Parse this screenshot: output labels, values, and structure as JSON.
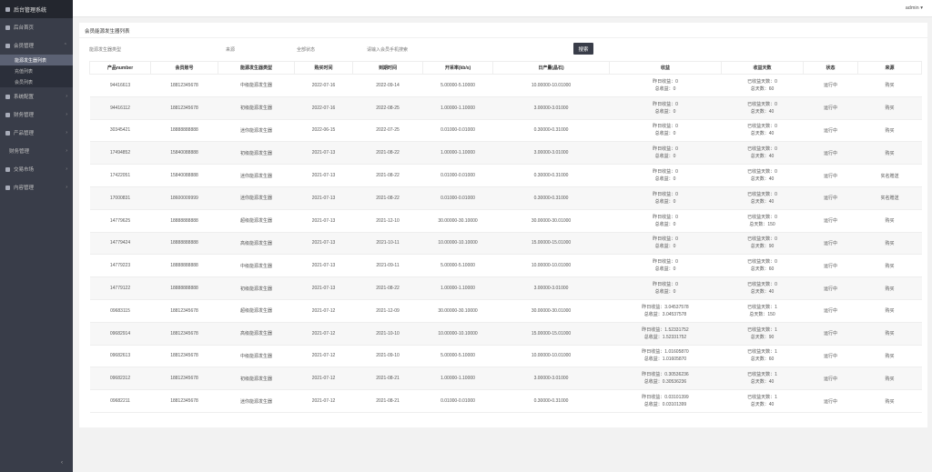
{
  "sidebar": {
    "logo_text": "后台管理系统",
    "items": [
      {
        "label": "后台首页",
        "icon": "home-icon",
        "has_arrow": false,
        "selected": false
      },
      {
        "label": "会员管理",
        "icon": "user-icon",
        "has_arrow": true,
        "selected": false,
        "expanded": true
      },
      {
        "label": "系统配置",
        "icon": "gear-icon",
        "has_arrow": true,
        "selected": false
      },
      {
        "label": "财务管理",
        "icon": "wallet-icon",
        "has_arrow": true,
        "selected": false
      },
      {
        "label": "产品管理",
        "icon": "box-icon",
        "has_arrow": true,
        "selected": false
      },
      {
        "label": "财务管理",
        "icon": "finance-icon",
        "has_arrow": true,
        "selected": false,
        "no_icon": true
      },
      {
        "label": "交易市场",
        "icon": "market-icon",
        "has_arrow": true,
        "selected": false
      },
      {
        "label": "内容管理",
        "icon": "doc-icon",
        "has_arrow": true,
        "selected": false
      }
    ],
    "submenu": [
      {
        "label": "能源发生器列表",
        "active": true
      },
      {
        "label": "充值列表",
        "active": false
      },
      {
        "label": "会员列表",
        "active": false
      }
    ],
    "collapse_glyph": "‹"
  },
  "topbar": {
    "user": "admin"
  },
  "panel": {
    "title": "会员能源发生器列表",
    "filters": [
      "能源发生器类型",
      "来源",
      "全部状态",
      "请输入会员手机搜索"
    ],
    "search_label": "搜索"
  },
  "table": {
    "columns": [
      "产品number",
      "会员账号",
      "能源发生器类型",
      "购买时间",
      "到期时间",
      "开采率(kb/s)",
      "日产量(晶石)",
      "收益",
      "收益天数",
      "状态",
      "来源"
    ],
    "rows": [
      {
        "id": "94416613",
        "account": "18812345678",
        "type": "中级能源发生器",
        "buy": "2022-07-16",
        "expire": "2022-09-14",
        "rate": "5.00000-5.10000",
        "daily": "10.00000-10.01000",
        "inc1": "昨日收益：0",
        "inc2": "总收益：0",
        "d1": "已收益天数：0",
        "d2": "总天数：60",
        "status": "运行中",
        "source": "购买"
      },
      {
        "id": "94416112",
        "account": "18812345678",
        "type": "初级能源发生器",
        "buy": "2022-07-16",
        "expire": "2022-08-25",
        "rate": "1.00000-1.10000",
        "daily": "3.00000-3.01000",
        "inc1": "昨日收益：0",
        "inc2": "总收益：0",
        "d1": "已收益天数：0",
        "d2": "总天数：40",
        "status": "运行中",
        "source": "购买"
      },
      {
        "id": "30345421",
        "account": "18888888888",
        "type": "迷你能源发生器",
        "buy": "2022-06-15",
        "expire": "2022-07-25",
        "rate": "0.01000-0.01000",
        "daily": "0.30000-0.31000",
        "inc1": "昨日收益：0",
        "inc2": "总收益：0",
        "d1": "已收益天数：0",
        "d2": "总天数：40",
        "status": "运行中",
        "source": "购买"
      },
      {
        "id": "17494852",
        "account": "15840088888",
        "type": "初级能源发生器",
        "buy": "2021-07-13",
        "expire": "2021-08-22",
        "rate": "1.00000-1.10000",
        "daily": "3.00000-3.01000",
        "inc1": "昨日收益：0",
        "inc2": "总收益：0",
        "d1": "已收益天数：0",
        "d2": "总天数：40",
        "status": "运行中",
        "source": "购买"
      },
      {
        "id": "17422051",
        "account": "15840088888",
        "type": "迷你能源发生器",
        "buy": "2021-07-13",
        "expire": "2021-08-22",
        "rate": "0.01000-0.01000",
        "daily": "0.30000-0.31000",
        "inc1": "昨日收益：0",
        "inc2": "总收益：0",
        "d1": "已收益天数：0",
        "d2": "总天数：40",
        "status": "运行中",
        "source": "实名赠送"
      },
      {
        "id": "17000831",
        "account": "18600009999",
        "type": "迷你能源发生器",
        "buy": "2021-07-13",
        "expire": "2021-08-22",
        "rate": "0.01000-0.01000",
        "daily": "0.30000-0.31000",
        "inc1": "昨日收益：0",
        "inc2": "总收益：0",
        "d1": "已收益天数：0",
        "d2": "总天数：40",
        "status": "运行中",
        "source": "实名赠送"
      },
      {
        "id": "14779625",
        "account": "18888888888",
        "type": "超级能源发生器",
        "buy": "2021-07-13",
        "expire": "2021-12-10",
        "rate": "30.00000-30.10000",
        "daily": "30.00000-30.01000",
        "inc1": "昨日收益：0",
        "inc2": "总收益：0",
        "d1": "已收益天数：0",
        "d2": "总天数：150",
        "status": "运行中",
        "source": "购买"
      },
      {
        "id": "14779424",
        "account": "18888888888",
        "type": "高级能源发生器",
        "buy": "2021-07-13",
        "expire": "2021-10-11",
        "rate": "10.00000-10.10000",
        "daily": "15.00000-15.01000",
        "inc1": "昨日收益：0",
        "inc2": "总收益：0",
        "d1": "已收益天数：0",
        "d2": "总天数：90",
        "status": "运行中",
        "source": "购买"
      },
      {
        "id": "14779223",
        "account": "18888888888",
        "type": "中级能源发生器",
        "buy": "2021-07-13",
        "expire": "2021-09-11",
        "rate": "5.00000-5.10000",
        "daily": "10.00000-10.01000",
        "inc1": "昨日收益：0",
        "inc2": "总收益：0",
        "d1": "已收益天数：0",
        "d2": "总天数：60",
        "status": "运行中",
        "source": "购买"
      },
      {
        "id": "14779122",
        "account": "18888888888",
        "type": "初级能源发生器",
        "buy": "2021-07-13",
        "expire": "2021-08-22",
        "rate": "1.00000-1.10000",
        "daily": "3.00000-3.01000",
        "inc1": "昨日收益：0",
        "inc2": "总收益：0",
        "d1": "已收益天数：0",
        "d2": "总天数：40",
        "status": "运行中",
        "source": "购买"
      },
      {
        "id": "09683115",
        "account": "18812345678",
        "type": "超级能源发生器",
        "buy": "2021-07-12",
        "expire": "2021-12-09",
        "rate": "30.00000-30.10000",
        "daily": "30.00000-30.01000",
        "inc1": "昨日收益：3.04537578",
        "inc2": "总收益：3.04537578",
        "d1": "已收益天数：1",
        "d2": "总天数：150",
        "status": "运行中",
        "source": "购买"
      },
      {
        "id": "09682914",
        "account": "18812345678",
        "type": "高级能源发生器",
        "buy": "2021-07-12",
        "expire": "2021-10-10",
        "rate": "10.00000-10.10000",
        "daily": "15.00000-15.01000",
        "inc1": "昨日收益：1.52331752",
        "inc2": "总收益：1.52331752",
        "d1": "已收益天数：1",
        "d2": "总天数：90",
        "status": "运行中",
        "source": "购买"
      },
      {
        "id": "09682613",
        "account": "18812345678",
        "type": "中级能源发生器",
        "buy": "2021-07-12",
        "expire": "2021-09-10",
        "rate": "5.00000-5.10000",
        "daily": "10.00000-10.01000",
        "inc1": "昨日收益：1.01605870",
        "inc2": "总收益：1.01605870",
        "d1": "已收益天数：1",
        "d2": "总天数：60",
        "status": "运行中",
        "source": "购买"
      },
      {
        "id": "09682312",
        "account": "18812345678",
        "type": "初级能源发生器",
        "buy": "2021-07-12",
        "expire": "2021-08-21",
        "rate": "1.00000-1.10000",
        "daily": "3.00000-3.01000",
        "inc1": "昨日收益：0.30536236",
        "inc2": "总收益：0.30536236",
        "d1": "已收益天数：1",
        "d2": "总天数：40",
        "status": "运行中",
        "source": "购买"
      },
      {
        "id": "09682211",
        "account": "18812345678",
        "type": "迷你能源发生器",
        "buy": "2021-07-12",
        "expire": "2021-08-21",
        "rate": "0.01000-0.01000",
        "daily": "0.30000-0.31000",
        "inc1": "昨日收益：0.03101399",
        "inc2": "总收益：0.03101399",
        "d1": "已收益天数：1",
        "d2": "总天数：40",
        "status": "运行中",
        "source": "购买"
      }
    ]
  }
}
